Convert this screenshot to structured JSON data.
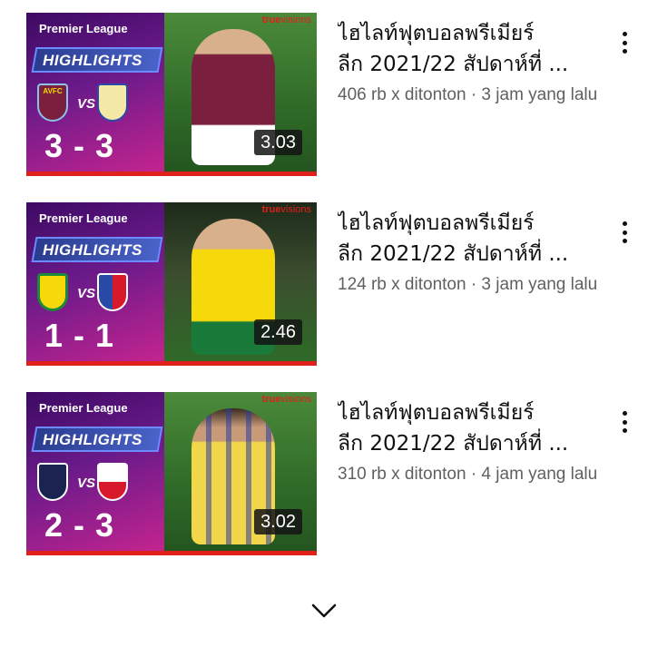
{
  "videos": [
    {
      "title_line1": "ไฮไลท์ฟุตบอลพรีเมียร์",
      "title_line2": "ลีก 2021/22 สัปดาห์ที่ ...",
      "info": "406 rb x ditonton · 3 jam yang lalu",
      "duration": "3.03",
      "thumb": {
        "league": "Premier League",
        "badge": "HIGHLIGHTS",
        "score": "3 - 3",
        "brand": "true",
        "brand2": "visions",
        "home_crest": "AVFC",
        "vs": "VS",
        "home_color": "#7a1f3d",
        "away_color": "#f5e9a8",
        "kit": "claret"
      }
    },
    {
      "title_line1": "ไฮไลท์ฟุตบอลพรีเมียร์",
      "title_line2": "ลีก 2021/22 สัปดาห์ที่ ...",
      "info": "124 rb x ditonton · 3 jam yang lalu",
      "duration": "2.46",
      "thumb": {
        "league": "Premier League",
        "badge": "HIGHLIGHTS",
        "score": "1 - 1",
        "brand": "true",
        "brand2": "visions",
        "home_crest": "",
        "vs": "VS",
        "home_color": "#1a8a3a",
        "away_color": "#2a4aa8",
        "kit": "yellow"
      }
    },
    {
      "title_line1": "ไฮไลท์ฟุตบอลพรีเมียร์",
      "title_line2": "ลีก 2021/22 สัปดาห์ที่ ...",
      "info": "310 rb x ditonton · 4 jam yang lalu",
      "duration": "3.02",
      "thumb": {
        "league": "Premier League",
        "badge": "HIGHLIGHTS",
        "score": "2 - 3",
        "brand": "true",
        "brand2": "visions",
        "home_crest": "",
        "vs": "VS",
        "home_color": "#1b2350",
        "away_color": "#d7192b",
        "kit": "saints"
      }
    }
  ],
  "icons": {
    "more": "more-vert-icon",
    "expand": "chevron-down-icon"
  },
  "colors": {
    "accent": "#e0201b",
    "title": "#0f0f0f",
    "meta": "#606060"
  }
}
